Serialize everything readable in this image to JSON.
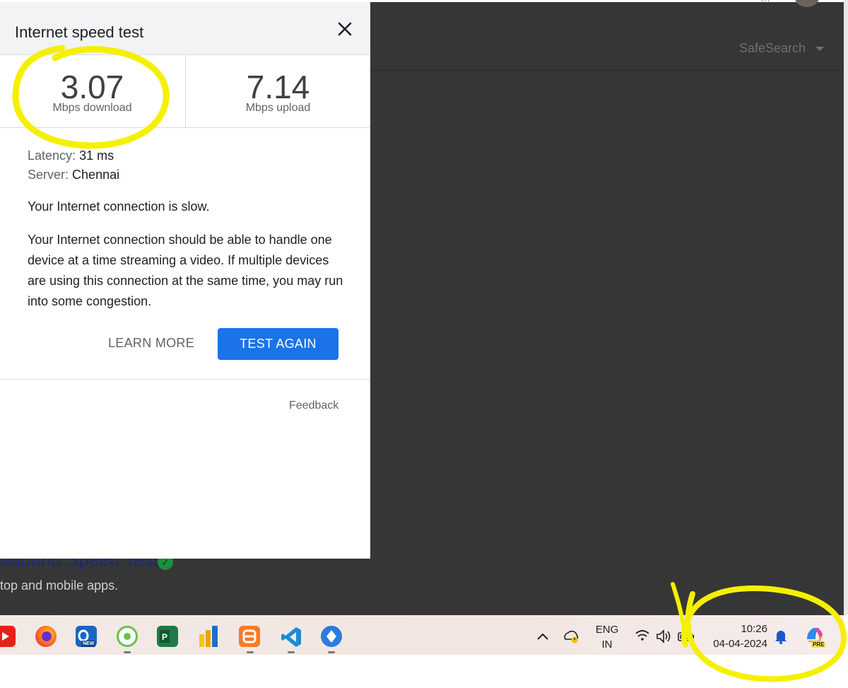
{
  "background": {
    "safesearch_label": "SafeSearch",
    "result_title": "adband Speed Test",
    "result_snippet": "top and mobile apps."
  },
  "dialog": {
    "title": "Internet speed test",
    "download": {
      "value": "3.07",
      "unit": "Mbps download"
    },
    "upload": {
      "value": "7.14",
      "unit": "Mbps upload"
    },
    "latency_label": "Latency:",
    "latency_value": "31 ms",
    "server_label": "Server:",
    "server_value": "Chennai",
    "status_text": "Your Internet connection is slow.",
    "description": "Your Internet connection should be able to handle one device at a time streaming a video. If multiple devices are using this connection at the same time, you may run into some congestion.",
    "learn_more_label": "LEARN MORE",
    "test_again_label": "TEST AGAIN",
    "feedback_label": "Feedback"
  },
  "taskbar": {
    "apps": [
      "youtube-icon",
      "firefox-icon",
      "outlook-new-icon",
      "greenshot-icon",
      "project-icon",
      "power-bi-icon",
      "xampp-icon",
      "vscode-icon",
      "app-icon"
    ],
    "outlook_badge": "NEW",
    "language_line1": "ENG",
    "language_line2": "IN",
    "time": "10:26",
    "date": "04-04-2024",
    "copilot_badge": "PRE"
  },
  "colors": {
    "accent": "#1a73e8",
    "highlight": "#f5f000",
    "page_background": "#363636"
  }
}
